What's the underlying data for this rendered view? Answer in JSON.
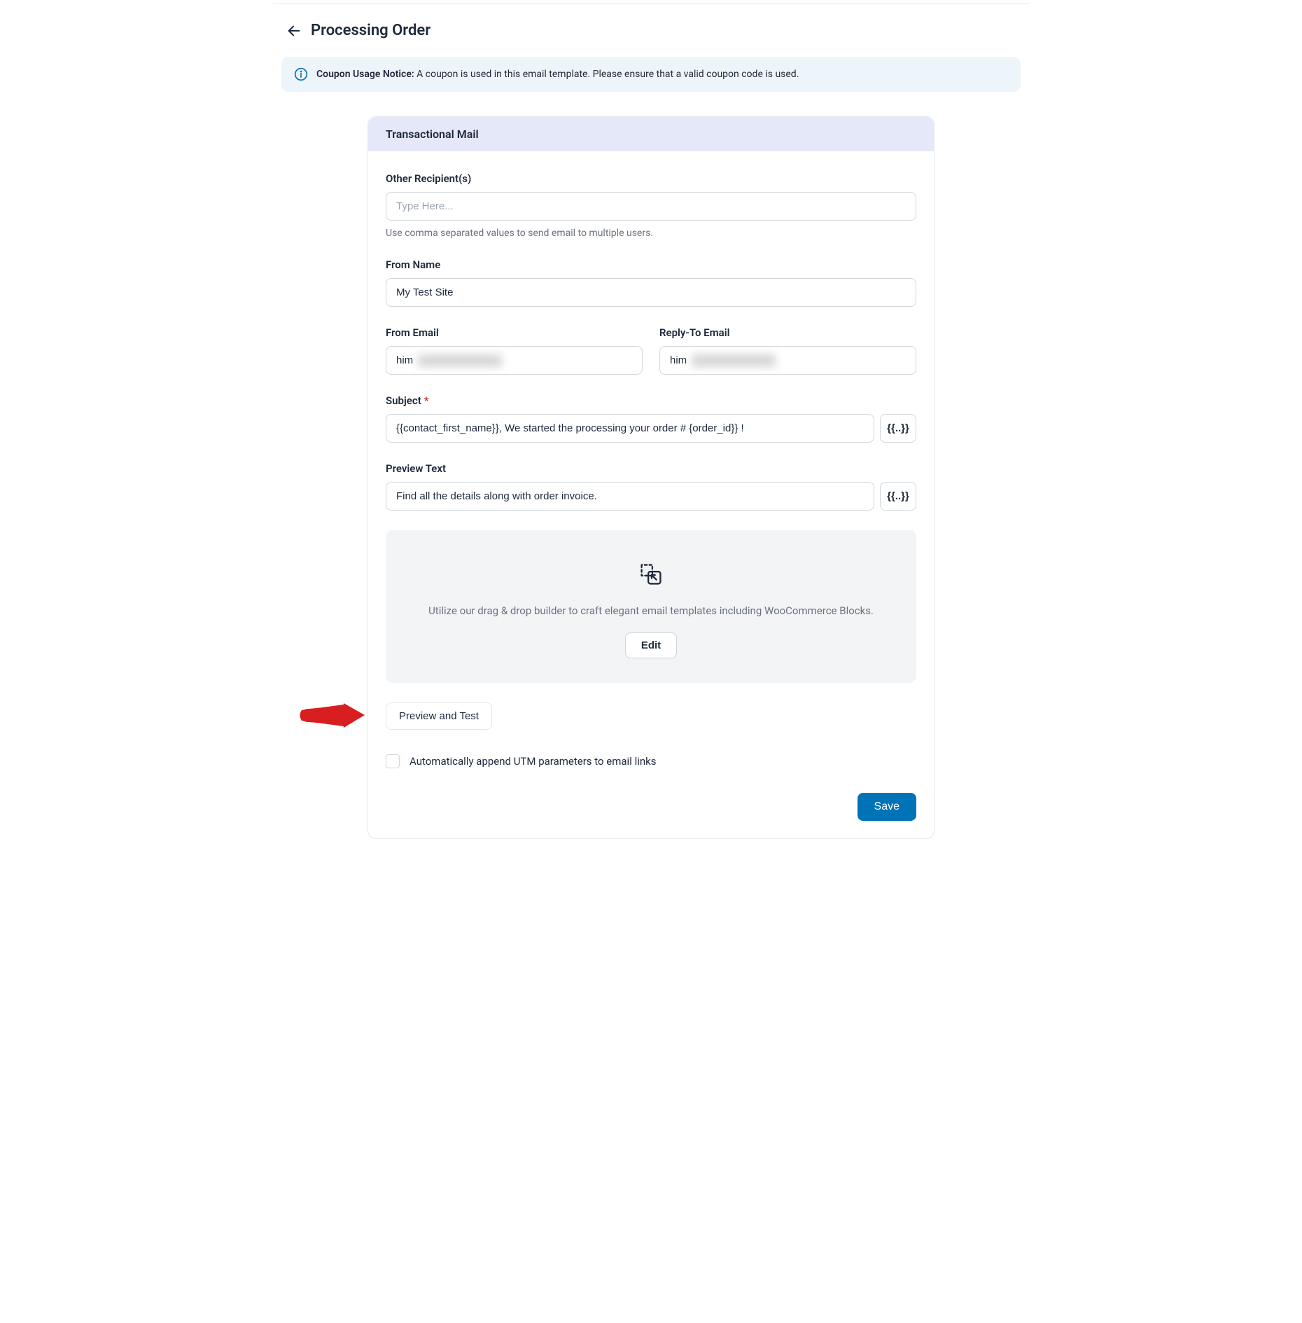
{
  "page": {
    "title": "Processing Order"
  },
  "notice": {
    "strong": "Coupon Usage Notice:",
    "text": " A coupon is used in this email template. Please ensure that a valid coupon code is used."
  },
  "card": {
    "header": "Transactional Mail"
  },
  "recipients": {
    "label": "Other Recipient(s)",
    "placeholder": "Type Here...",
    "helper": "Use comma separated values to send email to multiple users."
  },
  "from_name": {
    "label": "From Name",
    "value": "My Test Site"
  },
  "from_email": {
    "label": "From Email",
    "value": "him"
  },
  "reply_to": {
    "label": "Reply-To Email",
    "value": "him"
  },
  "subject": {
    "label": "Subject",
    "value": "{{contact_first_name}}, We started the processing your order # {order_id}} !"
  },
  "preview_text": {
    "label": "Preview Text",
    "value": "Find all the details along with order invoice."
  },
  "merge_tag": "{{..}}",
  "builder": {
    "desc": "Utilize our drag & drop builder to craft elegant email templates including WooCommerce Blocks.",
    "edit": "Edit"
  },
  "preview_test": "Preview and Test",
  "utm": {
    "label": "Automatically append UTM parameters to email links"
  },
  "save": "Save"
}
